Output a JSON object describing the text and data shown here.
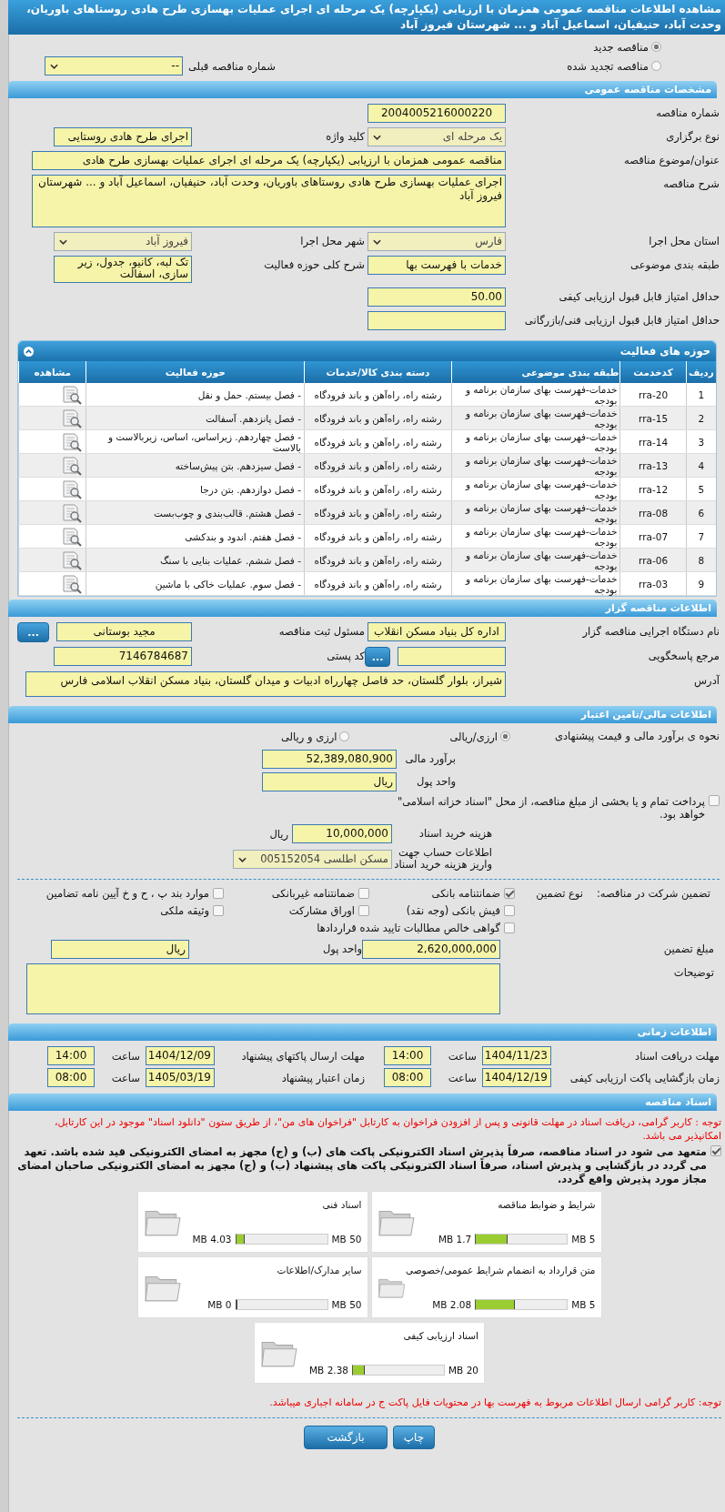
{
  "title": "مشاهده اطلاعات مناقصه عمومی همزمان با ارزیابی (یکپارچه) یک مرحله ای اجرای عملیات بهسازی طرح هادی روستاهای باوریان، وحدت آباد، حنیفیان، اسماعیل آباد و ... شهرستان فیروز آباد",
  "tender_status": [
    {
      "label": "مناقصه جدید",
      "selected": true
    },
    {
      "label": "مناقصه تجدید شده",
      "selected": false
    }
  ],
  "previous_number": {
    "label": "شماره مناقصه قبلی",
    "value": "--"
  },
  "general": {
    "header": "مشخصات مناقصه عمومی",
    "rows": [
      [
        {
          "label": "شماره مناقصه",
          "value": "2004005216000220",
          "kind": "input"
        }
      ],
      [
        {
          "label": "نوع برگزاری",
          "value": "یک مرحله ای",
          "kind": "select",
          "disabled": true
        },
        {
          "label": "کلید واژه",
          "value": "اجرای طرح هادی روستایی",
          "kind": "input"
        }
      ],
      [
        {
          "label": "عنوان/موضوع مناقصه",
          "value": "مناقصه عمومی همزمان با ارزیابی (یکپارچه) یک مرحله ای اجرای عملیات بهسازی طرح هادی",
          "kind": "wide"
        }
      ],
      [
        {
          "label": "شرح مناقصه",
          "value": "اجرای عملیات بهسازی طرح هادی روستاهای باوریان، وحدت آباد، حنیفیان، اسماعیل آباد و ... شهرستان فیروز آباد",
          "kind": "textarea"
        }
      ],
      [
        {
          "label": "استان محل اجرا",
          "value": "فارس",
          "kind": "select",
          "disabled": true
        },
        {
          "label": "شهر محل اجرا",
          "value": "فیروز آباد",
          "kind": "select",
          "disabled": true
        }
      ],
      [
        {
          "label": "طبقه بندی موضوعی",
          "value": "خدمات با فهرست بها",
          "kind": "input"
        },
        {
          "label": "شرح کلی حوزه فعالیت",
          "value": "تک لبه، کانیو، جدول، زیر سازی، اسفالت",
          "kind": "smallarea"
        }
      ],
      [
        {
          "label": "حداقل امتیاز قابل قبول ارزیابی کیفی",
          "value": "50.00",
          "kind": "input"
        }
      ],
      [
        {
          "label": "حداقل امتیاز قابل قبول ارزیابی فنی/بازرگانی",
          "kind": "input"
        }
      ]
    ]
  },
  "activities": {
    "header": "حوزه های فعالیت",
    "columns": [
      "ردیف",
      "کدخدمت",
      "طبقه بندی موضوعی",
      "دسته بندی کالا/خدمات",
      "حوزه فعالیت",
      "مشاهده"
    ],
    "rows": [
      [
        "1",
        "rra-20",
        "خدمات-فهرست بهای سازمان برنامه و بودجه",
        "رشته راه، راه‌آهن و باند فرودگاه",
        "- فصل بیستم. حمل و نقل"
      ],
      [
        "2",
        "rra-15",
        "خدمات-فهرست بهای سازمان برنامه و بودجه",
        "رشته راه، راه‌آهن و باند فرودگاه",
        "- فصل پانزدهم. آسفالت"
      ],
      [
        "3",
        "rra-14",
        "خدمات-فهرست بهای سازمان برنامه و بودجه",
        "رشته راه، راه‌آهن و باند فرودگاه",
        "- فصل چهاردهم. زیراساس، اساس، زیربالاست  و بالاست"
      ],
      [
        "4",
        "rra-13",
        "خدمات-فهرست بهای سازمان برنامه و بودجه",
        "رشته راه، راه‌آهن و باند فرودگاه",
        "- فصل سیزدهم. بتن پیش‌ساخته"
      ],
      [
        "5",
        "rra-12",
        "خدمات-فهرست بهای سازمان برنامه و بودجه",
        "رشته راه، راه‌آهن و باند فرودگاه",
        "- فصل دوازدهم. بتن درجا"
      ],
      [
        "6",
        "rra-08",
        "خدمات-فهرست بهای سازمان برنامه و بودجه",
        "رشته راه، راه‌آهن و باند فرودگاه",
        "- فصل هشتم. قالب‌بندی و چوب‌بست"
      ],
      [
        "7",
        "rra-07",
        "خدمات-فهرست بهای سازمان برنامه و بودجه",
        "رشته راه، راه‌آهن و باند فرودگاه",
        "- فصل هفتم. اندود و بندکشی"
      ],
      [
        "8",
        "rra-06",
        "خدمات-فهرست بهای سازمان برنامه و بودجه",
        "رشته راه، راه‌آهن و باند فرودگاه",
        "- فصل ششم. عملیات بنایی با سنگ"
      ],
      [
        "9",
        "rra-03",
        "خدمات-فهرست بهای سازمان برنامه و بودجه",
        "رشته راه، راه‌آهن و باند فرودگاه",
        "- فصل سوم. عملیات خاکی با ماشین"
      ]
    ]
  },
  "organizer": {
    "header": "اطلاعات مناقصه گزار",
    "rows": [
      [
        {
          "label": "نام دستگاه اجرایی مناقصه گزار",
          "value": "اداره کل بنیاد مسکن انقلاب",
          "kind": "input"
        },
        {
          "label": "مسئول ثبت مناقصه",
          "value": "مجید بوستانی",
          "kind": "input",
          "button": "..."
        }
      ],
      [
        {
          "label": "مرجع پاسخگویی",
          "kind": "input",
          "button": "..."
        },
        {
          "label": "کد پستی",
          "value": "7146784687",
          "kind": "input"
        }
      ],
      [
        {
          "label": "آدرس",
          "value": "شیراز، بلوار گلستان، حد فاصل چهارراه ادبیات و میدان گلستان، بنیاد مسکن انقلاب اسلامی فارس",
          "kind": "address"
        }
      ]
    ]
  },
  "finance": {
    "header": "اطلاعات مالی/تامین اعتبار",
    "estimate_method": {
      "label": "نحوه ی برآورد مالی و قیمت پیشنهادی",
      "options": [
        {
          "label": "ارزی/ریالی",
          "selected": true
        },
        {
          "label": "ارزی و ریالی",
          "selected": false
        }
      ]
    },
    "estimate": {
      "label": "برآورد مالی",
      "value": "52,389,080,900"
    },
    "currency": {
      "label": "واحد پول",
      "value": "ریال"
    },
    "treasury": {
      "label": "پرداخت تمام و یا بخشی از مبلغ مناقصه، از محل \"اسناد خزانه اسلامی\" خواهد بود.",
      "checked": false
    },
    "document_fee": {
      "label": "هزینه خرید اسناد",
      "value": "10,000,000",
      "unit": "ریال"
    },
    "account": {
      "label": "اطلاعات حساب جهت واریز هزینه خرید اسناد",
      "value": "مسکن اطلسی 005152054"
    },
    "guarantee": {
      "label": "تضمین شرکت در مناقصه:",
      "type_label": "نوع تضمین",
      "options": [
        {
          "label": "ضمانتنامه بانکی",
          "checked": true
        },
        {
          "label": "ضمانتنامه غیربانکی",
          "checked": false
        },
        {
          "label": "موارد بند پ ، ح و خ آیین نامه تضامین",
          "checked": false
        },
        {
          "label": "فیش بانکی (وجه نقد)",
          "checked": false
        },
        {
          "label": "اوراق مشارکت",
          "checked": false
        },
        {
          "label": "وثیقه ملکی",
          "checked": false
        },
        {
          "label": "گواهی خالص مطالبات تایید شده قراردادها",
          "checked": false
        }
      ],
      "amount": {
        "label": "مبلغ تضمین",
        "value": "2,620,000,000"
      },
      "currency": {
        "label": "واحد پول",
        "value": "ریال"
      },
      "notes": {
        "label": "توضیحات"
      }
    }
  },
  "schedule": {
    "header": "اطلاعات زمانی",
    "items": [
      {
        "label": "مهلت دریافت اسناد",
        "date": "1404/11/23",
        "hour_label": "ساعت",
        "hour": "14:00"
      },
      {
        "label": "مهلت ارسال پاکتهای پیشنهاد",
        "date": "1404/12/09",
        "hour_label": "ساعت",
        "hour": "14:00"
      },
      {
        "label": "زمان بازگشایی پاکت ارزیابی کیفی",
        "date": "1404/12/19",
        "hour_label": "ساعت",
        "hour": "08:00"
      },
      {
        "label": "زمان اعتبار پیشنهاد",
        "date": "1405/03/19",
        "hour_label": "ساعت",
        "hour": "08:00"
      }
    ]
  },
  "documents": {
    "header": "اسناد مناقصه",
    "notice": "توجه : کاربر گرامی، دریافت اسناد در مهلت قانونی و پس از افزودن فراخوان به کارتابل \"فراخوان های من\"، از طریق ستون \"دانلود اسناد\" موجود در این کارتابل، امکانپذیر می باشد.",
    "commitment": {
      "text": "متعهد می شود در اسناد مناقصه، صرفاً پذیرش اسناد الکترونیکی پاکت های (ب) و (ج) مجهز به امضای الکترونیکی قید شده باشد. تعهد می گردد در بازگشایی و پذیرش اسناد، صرفاً اسناد الکترونیکی پاکت های پیشنهاد (ب) و (ج) مجهز به امضای الکترونیکی صاحبان امضای مجاز مورد پذیرش واقع گردد.",
      "checked": true
    },
    "files": [
      {
        "title": "شرایط و ضوابط مناقصه",
        "used": "1.7 MB",
        "max": "5 MB",
        "level": 0.34
      },
      {
        "title": "اسناد فنی",
        "used": "4.03 MB",
        "max": "50 MB",
        "level": 0.08
      },
      {
        "title": "متن قرارداد به انضمام شرایط عمومی/خصوصی",
        "used": "2.08 MB",
        "max": "5 MB",
        "level": 0.42
      },
      {
        "title": "سایر مدارک/اطلاعات",
        "used": "0 MB",
        "max": "50 MB",
        "level": 0
      },
      {
        "title": "اسناد ارزیابی کیفی",
        "used": "2.38 MB",
        "max": "20 MB",
        "level": 0.12
      }
    ],
    "footer_note": "توجه: کاربر گرامی ارسال اطلاعات مربوط به فهرست بها در محتویات فایل پاکت ج در سامانه اجباری میباشد."
  },
  "buttons": [
    "چاپ",
    "بازگشت"
  ]
}
